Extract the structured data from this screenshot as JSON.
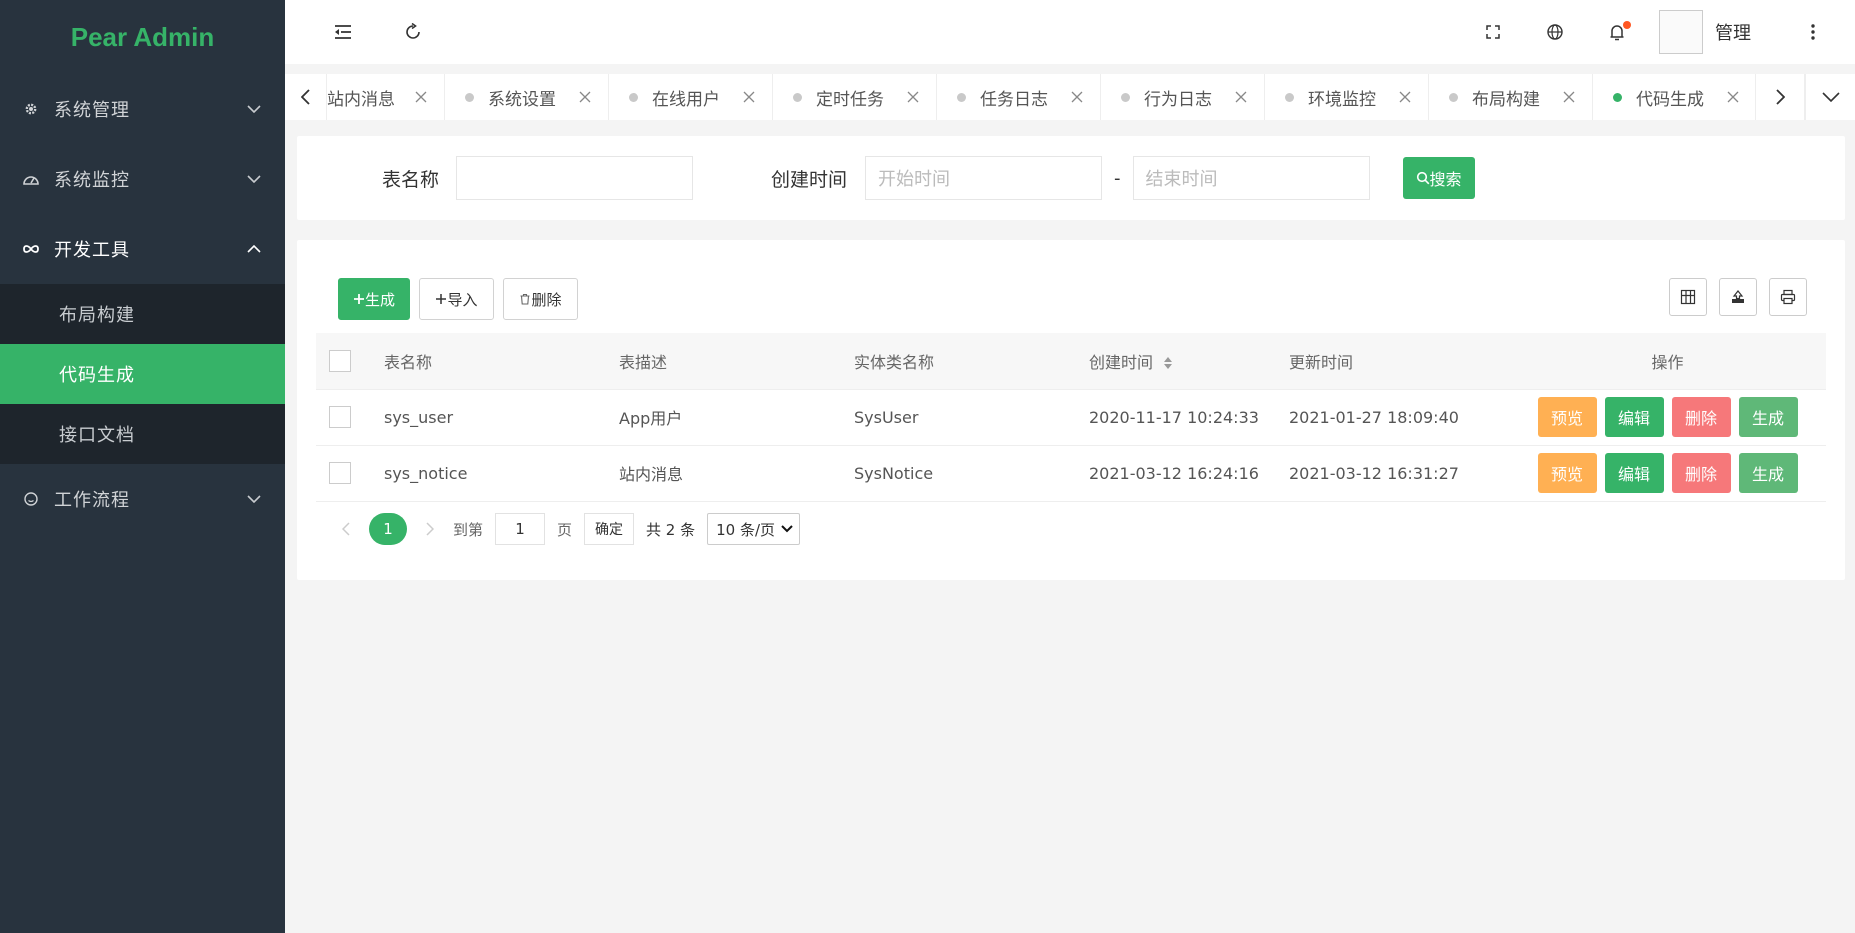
{
  "app": {
    "logo": "Pear Admin"
  },
  "sidebar": {
    "groups": [
      {
        "label": "系统管理",
        "icon": "gear-icon"
      },
      {
        "label": "系统监控",
        "icon": "dashboard-icon"
      },
      {
        "label": "开发工具",
        "icon": "infinity-icon",
        "children": [
          {
            "label": "布局构建"
          },
          {
            "label": "代码生成"
          },
          {
            "label": "接口文档"
          }
        ]
      },
      {
        "label": "工作流程",
        "icon": "circle-icon"
      }
    ]
  },
  "header": {
    "user_name": "管理"
  },
  "tabs": {
    "items": [
      {
        "label": "站内消息"
      },
      {
        "label": "系统设置"
      },
      {
        "label": "在线用户"
      },
      {
        "label": "定时任务"
      },
      {
        "label": "任务日志"
      },
      {
        "label": "行为日志"
      },
      {
        "label": "环境监控"
      },
      {
        "label": "布局构建"
      },
      {
        "label": "代码生成"
      }
    ],
    "active": "代码生成"
  },
  "search": {
    "table_name_label": "表名称",
    "table_name_value": "",
    "created_label": "创建时间",
    "start_placeholder": "开始时间",
    "separator": "-",
    "end_placeholder": "结束时间",
    "button": "搜索"
  },
  "toolbar": {
    "generate": "生成",
    "import": "导入",
    "delete": "删除"
  },
  "table": {
    "columns": [
      "表名称",
      "表描述",
      "实体类名称",
      "创建时间",
      "更新时间",
      "操作"
    ],
    "rows": [
      {
        "name": "sys_user",
        "desc": "App用户",
        "entity": "SysUser",
        "created": "2020-11-17 10:24:33",
        "updated": "2021-01-27 18:09:40"
      },
      {
        "name": "sys_notice",
        "desc": "站内消息",
        "entity": "SysNotice",
        "created": "2021-03-12 16:24:16",
        "updated": "2021-03-12 16:31:27"
      }
    ],
    "ops": {
      "preview": "预览",
      "edit": "编辑",
      "delete": "删除",
      "generate": "生成"
    }
  },
  "pager": {
    "current": "1",
    "goto_label": "到第",
    "goto_value": "1",
    "page_label": "页",
    "confirm": "确定",
    "total": "共 2 条",
    "page_size": "10 条/页"
  },
  "colors": {
    "brand": "#36b368",
    "sidebar": "#28333e",
    "preview": "#ffb053",
    "delete": "#f6787a"
  }
}
